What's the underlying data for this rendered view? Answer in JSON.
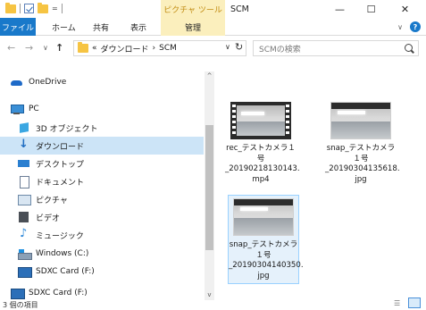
{
  "titlebar": {
    "context_tab": "ピクチャ ツール",
    "title": "SCM",
    "minimize": "—",
    "maximize": "☐",
    "close": "✕"
  },
  "ribbon": {
    "tabs": [
      "ファイル",
      "ホーム",
      "共有",
      "表示",
      "管理"
    ],
    "expand": "∨",
    "help": "?"
  },
  "address": {
    "back": "←",
    "forward": "→",
    "recent": "∨",
    "up": "↑",
    "path_prefix": "«",
    "path": [
      "ダウンロード",
      "SCM"
    ],
    "separator": "›",
    "dropdown": "∨",
    "refresh": "↻",
    "search_placeholder": "SCMの検索"
  },
  "nav": {
    "items": [
      {
        "label": "OneDrive",
        "icon": "onedrive-icon"
      },
      {
        "label": "PC",
        "icon": "pc-icon"
      },
      {
        "label": "3D オブジェクト",
        "icon": "3d-objects-icon"
      },
      {
        "label": "ダウンロード",
        "icon": "download-icon"
      },
      {
        "label": "デスクトップ",
        "icon": "desktop-icon"
      },
      {
        "label": "ドキュメント",
        "icon": "documents-icon"
      },
      {
        "label": "ピクチャ",
        "icon": "pictures-icon"
      },
      {
        "label": "ビデオ",
        "icon": "video-icon"
      },
      {
        "label": "ミュージック",
        "icon": "music-icon"
      },
      {
        "label": "Windows (C:)",
        "icon": "drive-icon"
      },
      {
        "label": "SDXC Card (F:)",
        "icon": "sdxc-icon"
      },
      {
        "label": "SDXC Card (F:)",
        "icon": "sdxc-icon"
      }
    ],
    "selected_index": 3,
    "scroll_up": "^",
    "scroll_down": "v"
  },
  "files": [
    {
      "name_lines": [
        "rec_テストカメラ１",
        "号",
        "_20190218130143.",
        "mp4"
      ],
      "type": "video"
    },
    {
      "name_lines": [
        "snap_テストカメラ",
        "１号",
        "_20190304135618.",
        "jpg"
      ],
      "type": "photo"
    },
    {
      "name_lines": [
        "snap_テストカメラ",
        "１号",
        "_20190304140350.",
        "jpg"
      ],
      "type": "photo",
      "selected": true
    }
  ],
  "status": {
    "count_text": "3 個の項目"
  }
}
